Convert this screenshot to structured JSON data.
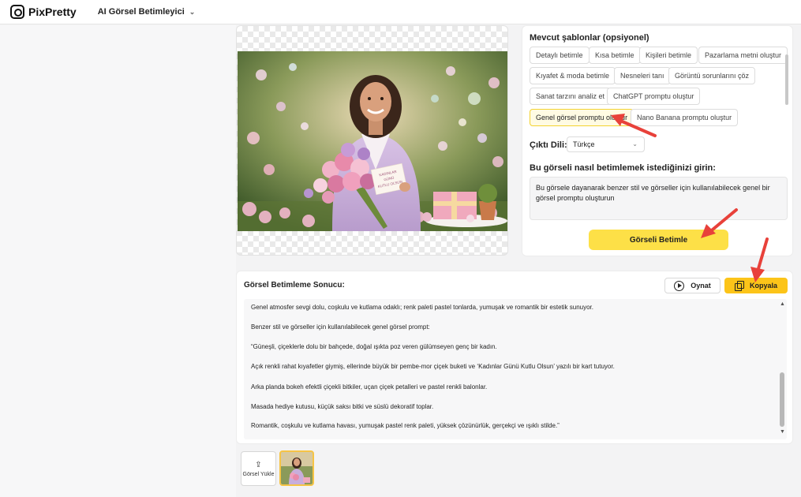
{
  "header": {
    "logo_text": "PixPretty",
    "app_name": "AI Görsel Betimleyici"
  },
  "templates": {
    "title": "Mevcut şablonlar (opsiyonel)",
    "items": [
      {
        "label": "Detaylı betimle"
      },
      {
        "label": "Kısa betimle"
      },
      {
        "label": "Kişileri betimle"
      },
      {
        "label": "Pazarlama metni oluştur"
      },
      {
        "label": "Kıyafet & moda betimle"
      },
      {
        "label": "Nesneleri tanı"
      },
      {
        "label": "Görüntü sorunlarını çöz"
      },
      {
        "label": "Sanat tarzını analiz et"
      },
      {
        "label": "ChatGPT promptu oluştur"
      },
      {
        "label": "Genel görsel promptu oluştur",
        "active": true
      },
      {
        "label": "Nano Banana promptu oluştur"
      }
    ]
  },
  "language": {
    "label": "Çıktı Dili:",
    "selected": "Türkçe"
  },
  "prompt": {
    "label": "Bu görseli nasıl betimlemek istediğinizi girin:",
    "value": "Bu görsele dayanarak benzer stil ve görseller için kullanılabilecek genel bir görsel promptu oluşturun"
  },
  "describe_button": "Görseli Betimle",
  "result": {
    "title": "Görsel Betimleme Sonucu:",
    "play_label": "Oynat",
    "copy_label": "Kopyala",
    "lines": [
      "Genel atmosfer sevgi dolu, coşkulu ve kutlama odaklı; renk paleti pastel tonlarda, yumuşak ve romantik bir estetik sunuyor.",
      "Benzer stil ve görseller için kullanılabilecek genel görsel prompt:",
      "“Güneşli, çiçeklerle dolu bir bahçede, doğal ışıkta poz veren gülümseyen genç bir kadın.",
      "Açık renkli rahat kıyafetler giymiş, ellerinde büyük bir pembe-mor çiçek buketi ve ‘Kadınlar Günü Kutlu Olsun’ yazılı bir kart tutuyor.",
      "Arka planda bokeh efektli çiçekli bitkiler, uçan çiçek petalleri ve pastel renkli balonlar.",
      "Masada hediye kutusu, küçük saksı bitki ve süslü dekoratif toplar.",
      "Romantik, coşkulu ve kutlama havası, yumuşak pastel renk paleti, yüksek çözünürlük, gerçekçi ve ışıklı stilde.”"
    ]
  },
  "photo_card": {
    "line1": "KADINLAR",
    "line2": "GÜNÜ",
    "line3": "KUTLU OLSUN"
  },
  "upload": {
    "label": "Görsel Yükle"
  },
  "colors": {
    "accent": "#fde047",
    "copy": "#fcc419",
    "arrow": "#e8413a"
  }
}
